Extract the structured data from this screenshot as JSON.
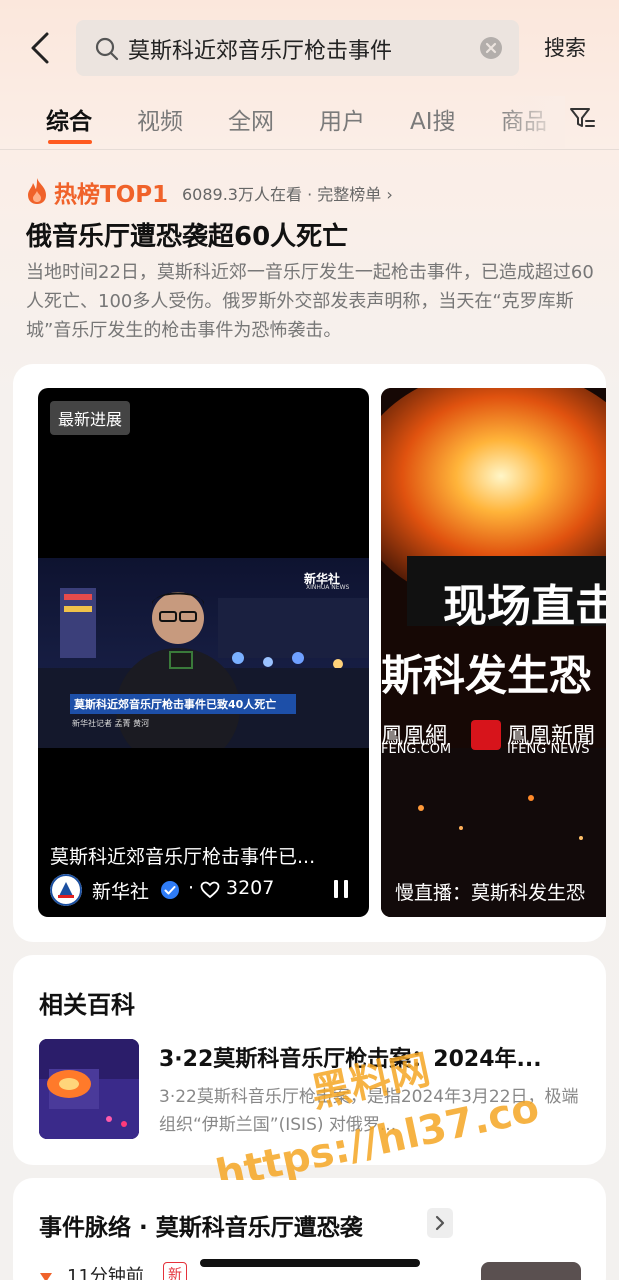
{
  "search": {
    "query": "莫斯科近郊音乐厅枪击事件",
    "button_label": "搜索"
  },
  "tabs": [
    {
      "label": "综合",
      "active": true
    },
    {
      "label": "视频",
      "active": false
    },
    {
      "label": "全网",
      "active": false
    },
    {
      "label": "用户",
      "active": false
    },
    {
      "label": "AI搜",
      "active": false
    },
    {
      "label": "商品",
      "active": false
    }
  ],
  "hot": {
    "badge": "热榜TOP1",
    "meta": "6089.3万人在看 · 完整榜单 ›",
    "headline": "俄音乐厅遭恐袭超60人死亡",
    "summary": "当地时间22日，莫斯科近郊一音乐厅发生一起枪击事件，已造成超过60人死亡、100多人受伤。俄罗斯外交部发表声明称，当天在“克罗库斯城”音乐厅发生的枪击事件为恐怖袭击。"
  },
  "videos": {
    "main": {
      "badge": "最新进展",
      "overlay_logo": "新华社",
      "overlay_logo_en": "XINHUA NEWS",
      "lower_third": "莫斯科近郊音乐厅枪击事件已致40人死亡",
      "reporter_line": "新华社记者  孟菁 黄河",
      "caption": "莫斯科近郊音乐厅枪击事件已...",
      "author": "新华社",
      "dot": "·",
      "likes": "3207"
    },
    "second": {
      "banner_title": "现场直击",
      "banner_sub": "斯科发生恐",
      "ifeng_a": "鳳凰網",
      "ifeng_a_en": "FENG.COM",
      "ifeng_b": "鳳凰新聞",
      "ifeng_b_en": "IFENG NEWS",
      "caption": "慢直播：莫斯科发生恐"
    }
  },
  "baike": {
    "section_title": "相关百科",
    "headline": "3·22莫斯科音乐厅枪击案：2024年...",
    "description": "3·22莫斯科音乐厅枪击案，是指2024年3月22日，极端组织“伊斯兰国”(ISIS) 对俄罗..."
  },
  "timeline": {
    "title": "事件脉络 · 莫斯科音乐厅遭恐袭",
    "time": "11分钟前",
    "new_badge": "新"
  },
  "watermark": {
    "line1": "黑料网",
    "line2": "https://hl37.co"
  },
  "colors": {
    "accent": "#ff5a1f",
    "hot_orange": "#f0622a",
    "verify_blue": "#2f7cf6",
    "watermark": "#f5a623"
  }
}
